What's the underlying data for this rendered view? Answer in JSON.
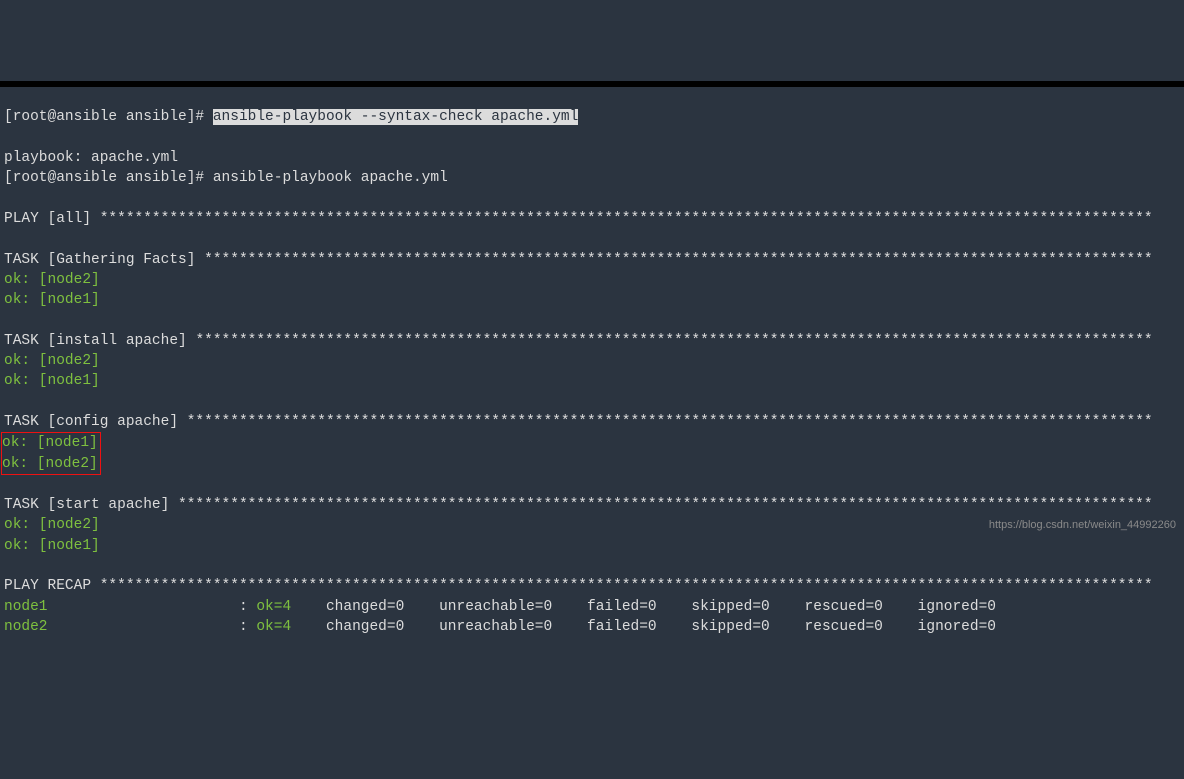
{
  "topline_fragment": "",
  "prompt1": {
    "prefix": "[root@ansible ansible]# ",
    "command": "ansible-playbook --syntax-check apache.yml"
  },
  "blank1": "",
  "playbook_line": "playbook: apache.yml",
  "prompt2": {
    "prefix": "[root@ansible ansible]# ",
    "command": "ansible-playbook apache.yml"
  },
  "blank2": "",
  "play_all": "PLAY [all] ",
  "play_all_asterisks": "*************************************************************************************************************************",
  "blank3": "",
  "task_gathering": "TASK [Gathering Facts] ",
  "task_gathering_asterisks": "*************************************************************************************************************",
  "ok_node2_1": "ok: [node2]",
  "ok_node1_1": "ok: [node1]",
  "blank4": "",
  "task_install": "TASK [install apache] ",
  "task_install_asterisks": "**************************************************************************************************************",
  "ok_node2_2": "ok: [node2]",
  "ok_node1_2": "ok: [node1]",
  "blank5": "",
  "task_config": "TASK [config apache] ",
  "task_config_asterisks": "***************************************************************************************************************",
  "ok_node1_3": "ok: [node1]",
  "ok_node2_3": "ok: [node2]",
  "blank6": "",
  "task_start": "TASK [start apache] ",
  "task_start_asterisks": "****************************************************************************************************************",
  "ok_node2_4": "ok: [node2]",
  "ok_node1_4": "ok: [node1]",
  "blank7": "",
  "play_recap": "PLAY RECAP ",
  "play_recap_asterisks": "*************************************************************************************************************************",
  "recap": {
    "node1": {
      "name": "node1",
      "spacer": "                      : ",
      "ok": "ok=4",
      "rest": "    changed=0    unreachable=0    failed=0    skipped=0    rescued=0    ignored=0   "
    },
    "node2": {
      "name": "node2",
      "spacer": "                      : ",
      "ok": "ok=4",
      "rest": "    changed=0    unreachable=0    failed=0    skipped=0    rescued=0    ignored=0   "
    }
  },
  "watermark": "https://blog.csdn.net/weixin_44992260"
}
